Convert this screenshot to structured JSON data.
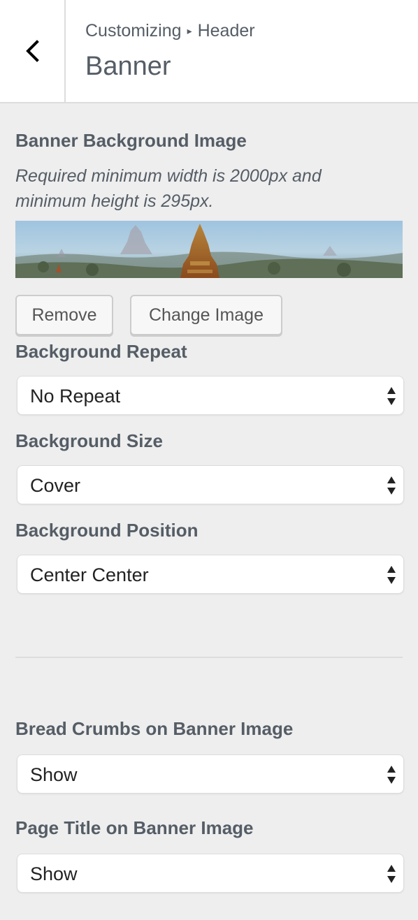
{
  "header": {
    "back_icon": "chevron-left-icon",
    "breadcrumb_root": "Customizing",
    "breadcrumb_separator": "▸",
    "breadcrumb_section": "Header",
    "title": "Banner"
  },
  "banner_image": {
    "label": "Banner Background Image",
    "description": "Required minimum width is 2000px and minimum height is 295px.",
    "remove_label": "Remove",
    "change_label": "Change Image"
  },
  "background_repeat": {
    "label": "Background Repeat",
    "value": "No Repeat"
  },
  "background_size": {
    "label": "Background Size",
    "value": "Cover"
  },
  "background_position": {
    "label": "Background Position",
    "value": "Center Center"
  },
  "breadcrumbs_on_banner": {
    "label": "Bread Crumbs on Banner Image",
    "value": "Show"
  },
  "page_title_on_banner": {
    "label": "Page Title on Banner Image",
    "value": "Show"
  },
  "select_icon": "updown-arrows-icon"
}
